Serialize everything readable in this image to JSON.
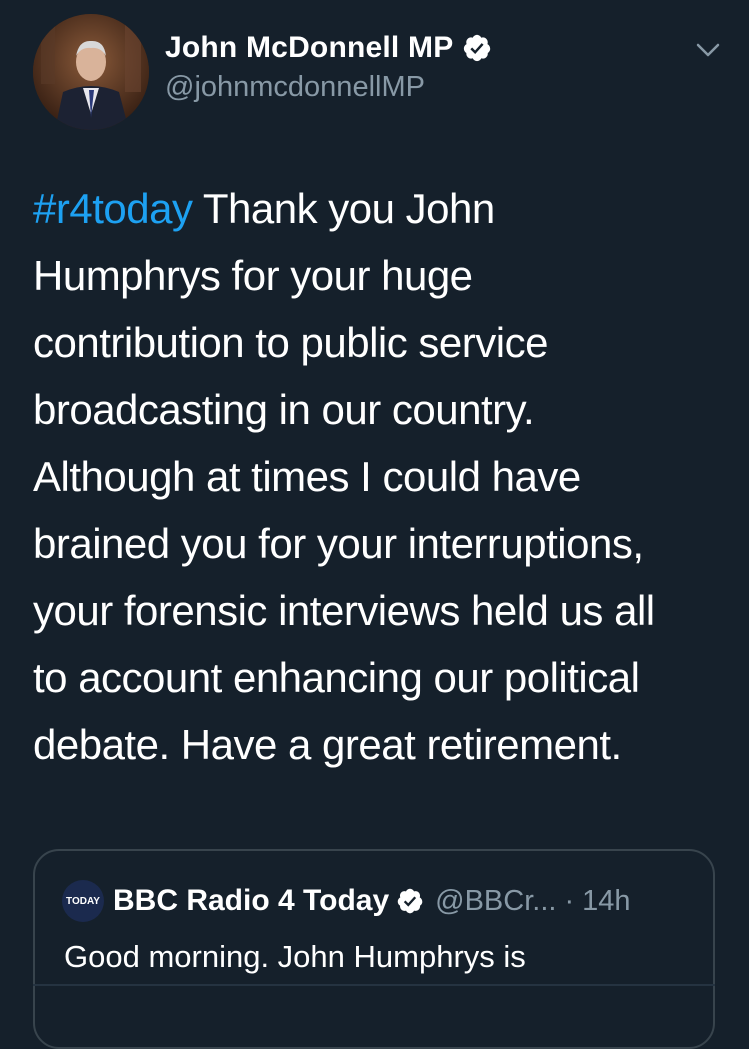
{
  "tweet": {
    "author": {
      "display_name": "John McDonnell MP",
      "handle": "@johnmcdonnellMP",
      "verified": true,
      "avatar_icon": "profile-photo"
    },
    "menu_icon": "chevron-down-icon",
    "hashtag": "#r4today",
    "lines": [
      " Thank you John",
      "Humphrys for your huge",
      "contribution to public service",
      "broadcasting in our country.",
      "Although at times I could have",
      "brained you for your interruptions,",
      "your forensic interviews held us all",
      "to account enhancing our political",
      "debate. Have a great retirement."
    ]
  },
  "quoted_tweet": {
    "avatar_text": "TODAY",
    "display_name": "BBC Radio 4 Today",
    "verified": true,
    "handle": "@BBCr...",
    "time": "· 14h",
    "text": "Good morning. John Humphrys is"
  },
  "colors": {
    "background": "#15202b",
    "text": "#ffffff",
    "secondary": "#8899a6",
    "accent": "#1da1f2",
    "border": "#38444d"
  }
}
